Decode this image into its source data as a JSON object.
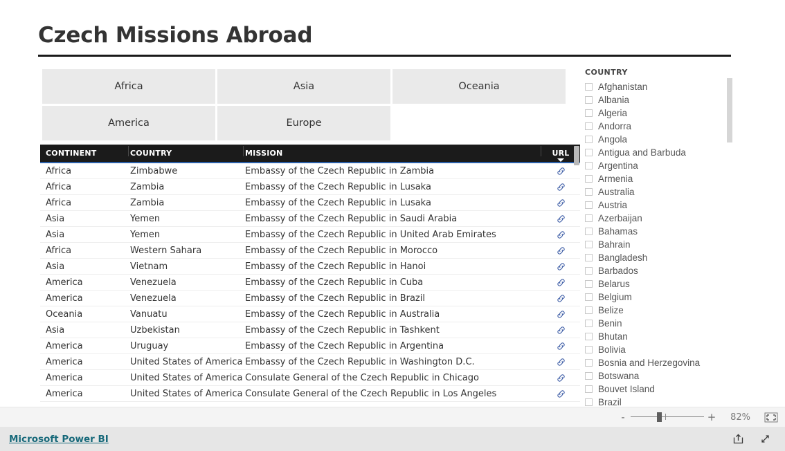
{
  "report": {
    "title": "Czech Missions Abroad"
  },
  "continent_slicer": {
    "buttons": [
      {
        "label": "Africa"
      },
      {
        "label": "Asia"
      },
      {
        "label": "Oceania"
      },
      {
        "label": "America"
      },
      {
        "label": "Europe"
      }
    ]
  },
  "table": {
    "columns": [
      {
        "key": "continent",
        "header": "CONTINENT"
      },
      {
        "key": "country",
        "header": "COUNTRY"
      },
      {
        "key": "mission",
        "header": "MISSION"
      },
      {
        "key": "url",
        "header": "URL",
        "sort": "descending"
      }
    ],
    "url_icon": "link-icon",
    "rows": [
      {
        "continent": "Africa",
        "country": "Zimbabwe",
        "mission": "Embassy of the Czech Republic in Zambia"
      },
      {
        "continent": "Africa",
        "country": "Zambia",
        "mission": "Embassy of the Czech Republic in Lusaka"
      },
      {
        "continent": "Africa",
        "country": "Zambia",
        "mission": "Embassy of the Czech Republic in Lusaka"
      },
      {
        "continent": "Asia",
        "country": "Yemen",
        "mission": "Embassy of the Czech Republic in Saudi Arabia"
      },
      {
        "continent": "Asia",
        "country": "Yemen",
        "mission": "Embassy of the Czech Republic in United Arab Emirates"
      },
      {
        "continent": "Africa",
        "country": "Western Sahara",
        "mission": "Embassy of the Czech Republic in Morocco"
      },
      {
        "continent": "Asia",
        "country": "Vietnam",
        "mission": "Embassy of the Czech Republic in Hanoi"
      },
      {
        "continent": "America",
        "country": "Venezuela",
        "mission": "Embassy of the Czech Republic in Cuba"
      },
      {
        "continent": "America",
        "country": "Venezuela",
        "mission": "Embassy of the Czech Republic in Brazil"
      },
      {
        "continent": "Oceania",
        "country": "Vanuatu",
        "mission": "Embassy of the Czech Republic in Australia"
      },
      {
        "continent": "Asia",
        "country": "Uzbekistan",
        "mission": "Embassy of the Czech Republic in Tashkent"
      },
      {
        "continent": "America",
        "country": "Uruguay",
        "mission": "Embassy of the Czech Republic in Argentina"
      },
      {
        "continent": "America",
        "country": "United States of America",
        "mission": "Embassy of the Czech Republic in Washington D.C."
      },
      {
        "continent": "America",
        "country": "United States of America",
        "mission": "Consulate General of the Czech Republic in Chicago"
      },
      {
        "continent": "America",
        "country": "United States of America",
        "mission": "Consulate General of the Czech Republic in Los Angeles"
      }
    ]
  },
  "country_slicer": {
    "title": "COUNTRY",
    "items": [
      {
        "label": "Afghanistan",
        "checked": false
      },
      {
        "label": "Albania",
        "checked": false
      },
      {
        "label": "Algeria",
        "checked": false
      },
      {
        "label": "Andorra",
        "checked": false
      },
      {
        "label": "Angola",
        "checked": false
      },
      {
        "label": "Antigua and Barbuda",
        "checked": false
      },
      {
        "label": "Argentina",
        "checked": false
      },
      {
        "label": "Armenia",
        "checked": false
      },
      {
        "label": "Australia",
        "checked": false
      },
      {
        "label": "Austria",
        "checked": false
      },
      {
        "label": "Azerbaijan",
        "checked": false
      },
      {
        "label": "Bahamas",
        "checked": false
      },
      {
        "label": "Bahrain",
        "checked": false
      },
      {
        "label": "Bangladesh",
        "checked": false
      },
      {
        "label": "Barbados",
        "checked": false
      },
      {
        "label": "Belarus",
        "checked": false
      },
      {
        "label": "Belgium",
        "checked": false
      },
      {
        "label": "Belize",
        "checked": false
      },
      {
        "label": "Benin",
        "checked": false
      },
      {
        "label": "Bhutan",
        "checked": false
      },
      {
        "label": "Bolivia",
        "checked": false
      },
      {
        "label": "Bosnia and Herzegovina",
        "checked": false
      },
      {
        "label": "Botswana",
        "checked": false
      },
      {
        "label": "Bouvet Island",
        "checked": false
      },
      {
        "label": "Brazil",
        "checked": false
      }
    ]
  },
  "statusbar": {
    "zoom_out_label": "-",
    "zoom_in_label": "+",
    "zoom_value": "82%",
    "fit_icon": "fit-to-page-icon"
  },
  "footer": {
    "brand": "Microsoft Power BI",
    "share_icon": "share-icon",
    "fullscreen_icon": "fullscreen-icon"
  },
  "colors": {
    "accent_header": "#1b1b1b",
    "header_underline": "#2b5fa8",
    "slicer_button": "#eaeaea",
    "link": "#17697a",
    "url_icon": "#3b5ba5"
  }
}
